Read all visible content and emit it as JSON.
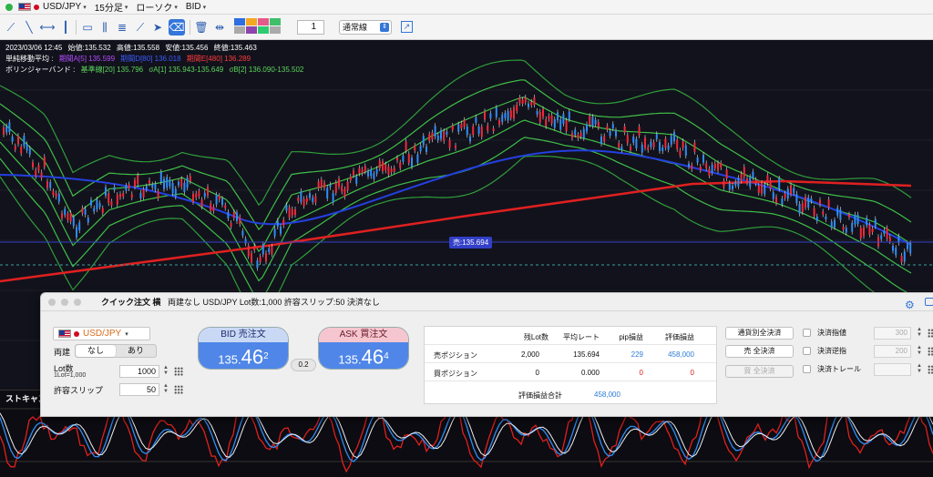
{
  "topbar": {
    "symbol": "USD/JPY",
    "timeframe": "15分足",
    "chart_type": "ローソク",
    "price_side": "BID"
  },
  "toolbar": {
    "line_width": "1",
    "line_style": "通常線",
    "palette_colors": [
      "#2d6ee0",
      "#f5a623",
      "#e55a8a",
      "#3fbf6a",
      "#aaaaaa",
      "#8e44ad",
      "#2ecc71",
      "#aaaaaa"
    ]
  },
  "chart_info": {
    "ohlc": {
      "datetime": "2023/03/06 12:45",
      "open": "始値:135.532",
      "high": "高値:135.558",
      "low": "安値:135.456",
      "close": "終値:135.463"
    },
    "ma": {
      "label": "単純移動平均 :",
      "a": "期間A[5] 135.599",
      "d": "期間D[80] 136.018",
      "e": "期間E[480] 136.289"
    },
    "bb": {
      "label": "ボリンジャーバンド :",
      "basis": "基準線[20] 135.796",
      "s1": "σA[1] 135.943-135.649",
      "s2": "σB[2] 136.090-135.502"
    },
    "price_tag": "売:135.694"
  },
  "sub_chart": {
    "label": "ストキャス"
  },
  "dialog": {
    "title": "クイック注文 横",
    "subtitle": "両建なし USD/JPY Lot数:1,000 許容スリップ:50 決済なし",
    "currency": "USD/JPY",
    "hedge_label": "両建",
    "hedge_off": "なし",
    "hedge_on": "あり",
    "lot_label": "Lot数",
    "lot_unit": "1Lot=1,000",
    "lot_value": "1000",
    "slip_label": "許容スリップ",
    "slip_value": "50",
    "bid": {
      "label": "BID 売注文",
      "prefix": "135.",
      "big": "46",
      "sup": "2"
    },
    "ask": {
      "label": "ASK 買注文",
      "prefix": "135.",
      "big": "46",
      "sup": "4"
    },
    "spread": "0.2",
    "positions": {
      "headers": [
        "残Lot数",
        "平均レート",
        "pip損益",
        "評価損益"
      ],
      "rows": [
        {
          "label": "売ポジション",
          "lots": "2,000",
          "rate": "135.694",
          "pip": "229",
          "pl": "458,000"
        },
        {
          "label": "買ポジション",
          "lots": "0",
          "rate": "0.000",
          "pip": "0",
          "pl": "0"
        }
      ],
      "total_label": "評価損益合計",
      "total_value": "458,000"
    },
    "buttons": {
      "close_all_ccy": "通貨別全決済",
      "sell_close_all": "売 全決済",
      "buy_close_all": "買 全決済"
    },
    "settle": {
      "limit_label": "決済指値",
      "limit_value": "300",
      "stop_label": "決済逆指",
      "stop_value": "200",
      "trail_label": "決済トレール"
    }
  }
}
